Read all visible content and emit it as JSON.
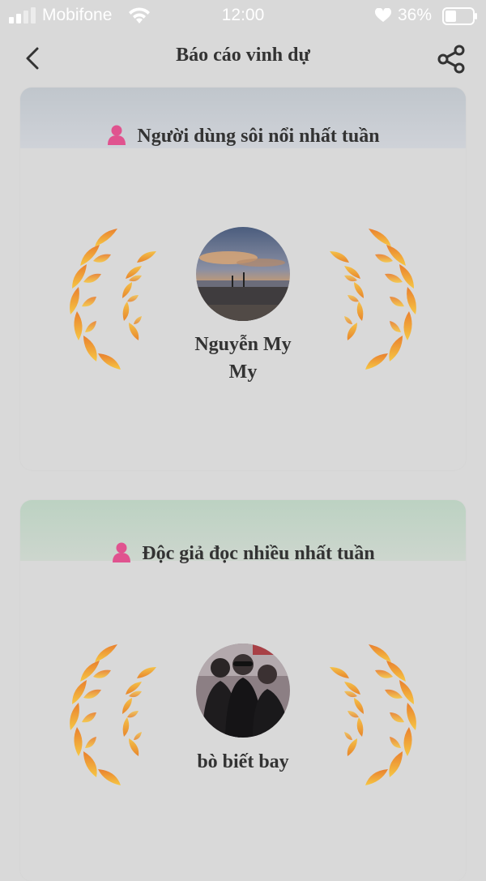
{
  "status_bar": {
    "carrier": "Mobifone",
    "time": "12:00",
    "battery": "36%"
  },
  "header": {
    "title": "Báo cáo vinh dự",
    "back_icon": "chevron-left-icon",
    "share_icon": "share-icon"
  },
  "awards": [
    {
      "title": "Người dùng sôi nổi nhất tuần",
      "user_name_line1": "Nguyễn My",
      "user_name_line2": "My"
    },
    {
      "title": "Độc giả đọc nhiều nhất tuần",
      "user_name_line1": "bò biết bay"
    }
  ],
  "colors": {
    "background": "#d9d9d9",
    "text": "#333333",
    "laurel_outer": "#e8962c",
    "laurel_inner": "#f3c23a",
    "person_icon": "#e0538f"
  }
}
